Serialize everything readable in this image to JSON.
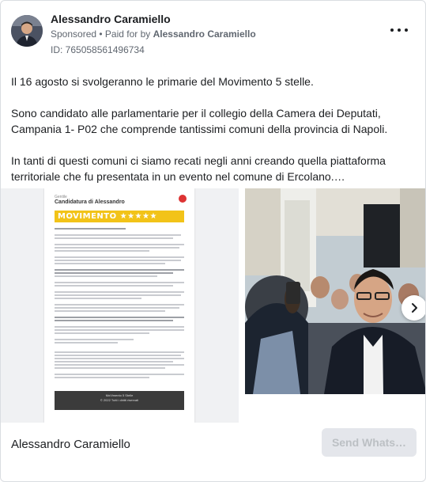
{
  "advertiser": {
    "name": "Alessandro Caramiello",
    "sponsored": "Sponsored",
    "separator": " • ",
    "paid_for_prefix": "Paid for by ",
    "paid_for_by": "Alessandro Caramiello",
    "ad_id": "ID: 765058561496734"
  },
  "menu_icon": "more-horizontal-icon",
  "body": {
    "paragraphs": [
      "Il 16 agosto si svolgeranno le primarie del Movimento 5 stelle.",
      "Sono candidato alle parlamentarie per il collegio della Camera dei Deputati, Campania 1- P02 che comprende tantissimi comuni della provincia di Napoli.",
      "In tanti di questi comuni ci siamo recati negli anni creando quella piattaforma territoriale che fu presentata in un evento nel comune di Ercolano.…"
    ]
  },
  "carousel": {
    "doc_card": {
      "small_header": "Gentile",
      "title": "Candidatura di Alessandro",
      "banner": "MOVIMENTO ★★★★★",
      "footer_lines": [
        "MoVimento 5 Stelle",
        "© 2022 Tutti i diritti riservati"
      ]
    },
    "next_icon": "chevron-right-icon"
  },
  "footer": {
    "page_name": "Alessandro Caramiello",
    "cta_label": "Send Whats…"
  },
  "colors": {
    "banner_yellow": "#f2c318",
    "cta_bg": "#e4e6eb",
    "cta_text": "#bcc0c4",
    "meta_text": "#606770"
  }
}
